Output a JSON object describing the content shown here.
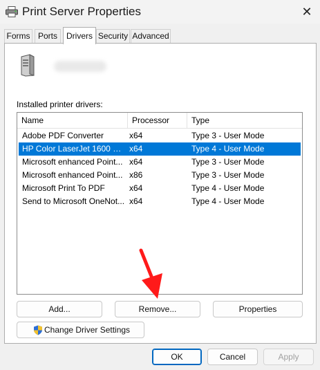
{
  "window": {
    "title": "Print Server Properties"
  },
  "tabs": [
    {
      "label": "Forms"
    },
    {
      "label": "Ports"
    },
    {
      "label": "Drivers"
    },
    {
      "label": "Security"
    },
    {
      "label": "Advanced"
    }
  ],
  "drivers_tab": {
    "list_caption": "Installed printer drivers:",
    "columns": {
      "name": "Name",
      "processor": "Processor",
      "type": "Type"
    },
    "rows": [
      {
        "name": "Adobe PDF Converter",
        "processor": "x64",
        "type": "Type 3 - User Mode",
        "selected": false
      },
      {
        "name": "HP Color LaserJet 1600 Cla...",
        "processor": "x64",
        "type": "Type 4 - User Mode",
        "selected": true
      },
      {
        "name": "Microsoft enhanced Point...",
        "processor": "x64",
        "type": "Type 3 - User Mode",
        "selected": false
      },
      {
        "name": "Microsoft enhanced Point...",
        "processor": "x86",
        "type": "Type 3 - User Mode",
        "selected": false
      },
      {
        "name": "Microsoft Print To PDF",
        "processor": "x64",
        "type": "Type 4 - User Mode",
        "selected": false
      },
      {
        "name": "Send to Microsoft OneNot...",
        "processor": "x64",
        "type": "Type 4 - User Mode",
        "selected": false
      }
    ],
    "buttons": {
      "add": "Add...",
      "remove": "Remove...",
      "properties": "Properties",
      "change_driver_settings": "Change Driver Settings"
    }
  },
  "footer": {
    "ok": "OK",
    "cancel": "Cancel",
    "apply": "Apply"
  },
  "annotation": {
    "arrow_color": "#ff1a1a",
    "arrow_target": "Remove..."
  },
  "colors": {
    "selection": "#0078d7",
    "primary_border": "#0067c0"
  }
}
